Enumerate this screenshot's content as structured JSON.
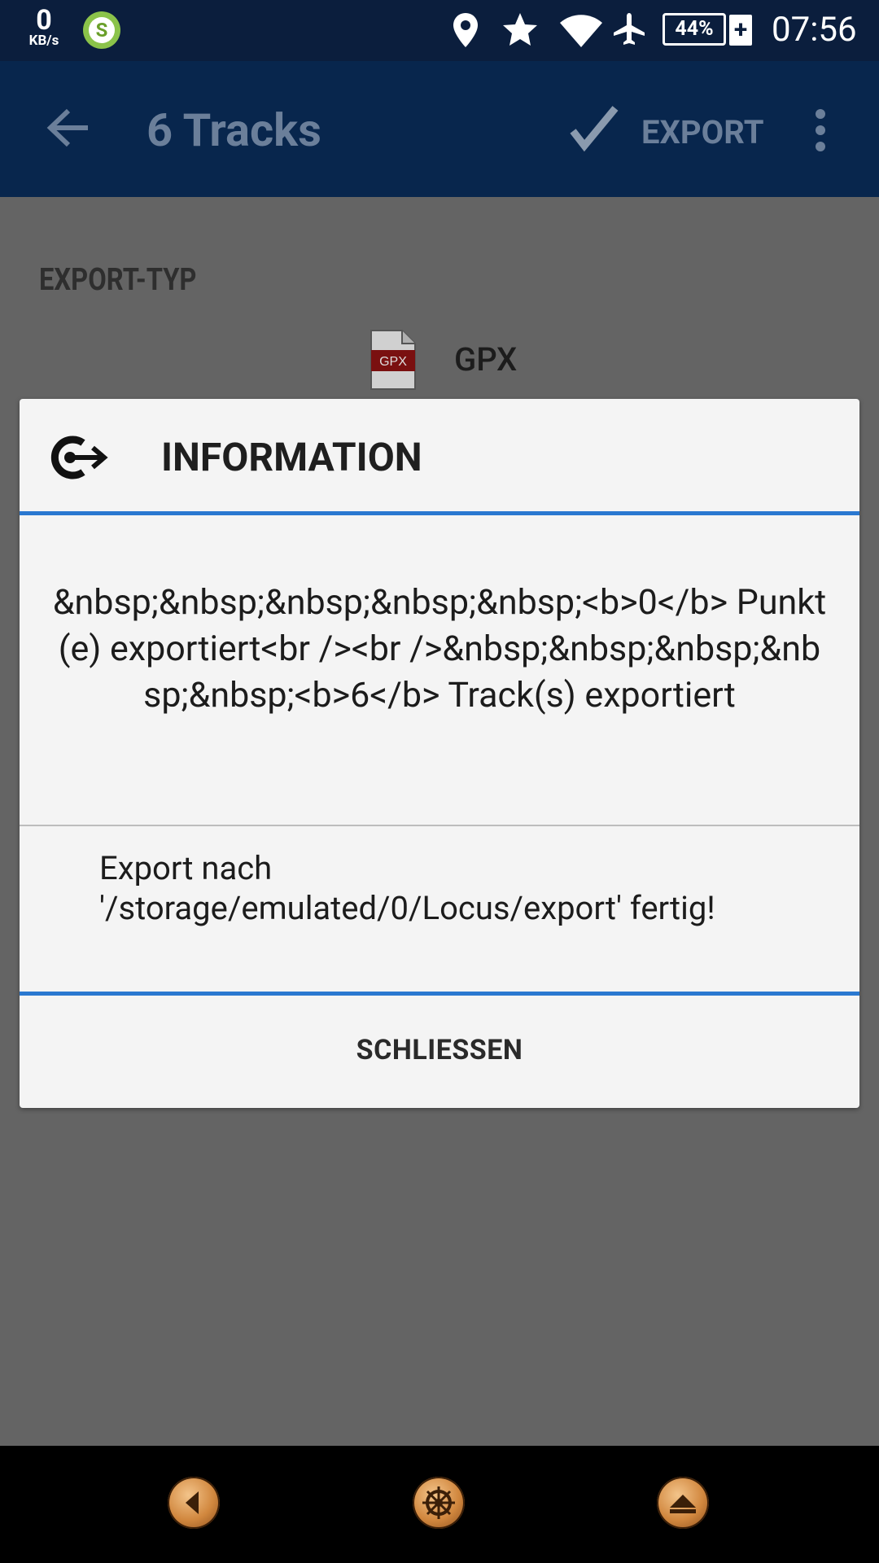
{
  "status_bar": {
    "net_speed_value": "0",
    "net_speed_unit": "KB/s",
    "app_badge": "S",
    "battery": "44%",
    "battery_plus": "+",
    "time": "07:56"
  },
  "app_bar": {
    "title": "6 Tracks",
    "export_label": "EXPORT"
  },
  "content": {
    "section_label": "EXPORT-TYP",
    "file_badge": "GPX",
    "file_type": "GPX"
  },
  "dialog": {
    "title": "INFORMATION",
    "body": "&nbsp;&nbsp;&nbsp;&nbsp;&nbsp;<b>0</b> Punkt(e) exportiert<br /><br />&nbsp;&nbsp;&nbsp;&nbsp;&nbsp;<b>6</b> Track(s) exportiert",
    "path_message": "Export nach '/storage/emulated/0/Locus/export' fertig!",
    "close_label": "SCHLIESSEN"
  },
  "colors": {
    "status_bar": "#0b1e3d",
    "app_bar": "#08264d",
    "accent": "#2a78d0",
    "dim_overlay": "#646464"
  }
}
